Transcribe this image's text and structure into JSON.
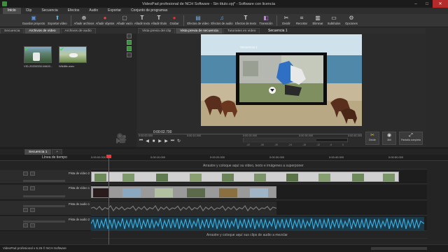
{
  "app": {
    "title": "VideoPad profesional de NCH Software - Sin titulo.vpj* - Software con licencia",
    "window_controls": [
      "minimize-icon",
      "maximize-icon",
      "close-icon"
    ]
  },
  "menu": [
    {
      "label": "Inicio",
      "active": true
    },
    {
      "label": "Clip"
    },
    {
      "label": "Secuencia"
    },
    {
      "label": "Efectos"
    },
    {
      "label": "Audio"
    },
    {
      "label": "Exportar"
    },
    {
      "label": "Conjunto de programas"
    }
  ],
  "toolbar": {
    "items": [
      {
        "label": "Abrir",
        "icon": "folder-icon",
        "color": "#e8b84a"
      },
      {
        "label": "Guardar proyecto",
        "icon": "disk-icon",
        "color": "#5d8fd8"
      },
      {
        "label": "Exportar vídeo",
        "icon": "export-icon",
        "color": "#5fb0e0"
      },
      {
        "label": "Añadir archivos",
        "icon": "add-files-icon",
        "color": "#e0e0e0"
      },
      {
        "label": "Añadir objetos",
        "icon": "add-objects-icon",
        "color": "#d84a4a"
      },
      {
        "label": "Añadir vacío",
        "icon": "add-blank-icon",
        "color": "#aaaaaa"
      },
      {
        "label": "Añadir texto",
        "icon": "text-icon",
        "color": "#e0e0e0"
      },
      {
        "label": "Añadir título",
        "icon": "title-icon",
        "color": "#e0e0e0"
      },
      {
        "label": "Grabar",
        "icon": "record-icon",
        "color": "#e03030"
      },
      {
        "label": "Efectos de vídeo",
        "icon": "video-fx-icon",
        "color": "#7ab0e0"
      },
      {
        "label": "Efectos de audio",
        "icon": "audio-fx-icon",
        "color": "#7ab0e0"
      },
      {
        "label": "Efectos de texto",
        "icon": "text-fx-icon",
        "color": "#e0e0e0"
      },
      {
        "label": "Transición",
        "icon": "transition-icon",
        "color": "#c080e0"
      },
      {
        "label": "Dividir",
        "icon": "split-icon",
        "color": "#e0e0e0"
      },
      {
        "label": "Recortar",
        "icon": "crop-icon",
        "color": "#e0e0e0"
      },
      {
        "label": "Eliminar",
        "icon": "delete-icon",
        "color": "#e0e0e0"
      },
      {
        "label": "Subtítulos",
        "icon": "subtitles-icon",
        "color": "#e0e0e0"
      },
      {
        "label": "Opciones",
        "icon": "gear-icon",
        "color": "#cccccc"
      }
    ]
  },
  "media_panel": {
    "tabs": [
      {
        "label": "Secuencia"
      },
      {
        "label": "Archivos de vídeo",
        "active": true
      },
      {
        "label": "Archivos de audio"
      }
    ],
    "files": [
      {
        "name": "VID-20200330-WA00...",
        "icon": "check-icon"
      },
      {
        "name": "Wildlife.wmv",
        "icon": "check-icon"
      }
    ],
    "side_tools": [
      "add-icon",
      "remove-icon",
      "grid-icon",
      "list-icon"
    ]
  },
  "preview_panel": {
    "tabs": [
      {
        "label": "Vista previa del clip"
      },
      {
        "label": "Vista previa de secuencia",
        "active": true
      },
      {
        "label": "Tutoriales en vídeo"
      }
    ],
    "sequence_label": "Secuencia 1",
    "overlay_text": "Secuencia 1",
    "timecode": "0:00:02.700",
    "seek_ticks": [
      "0:00:00.000",
      "0:00:10.000",
      "0:00:20.000",
      "0:00:30.000",
      "0:00:40.000"
    ],
    "volume_ticks": [
      "-42",
      "-36",
      "-30",
      "-24",
      "-18",
      "-12",
      "-6",
      "0"
    ],
    "buttons": [
      {
        "label": "Dividir",
        "icon": "scissors-icon"
      },
      {
        "label": "360",
        "icon": "vr-icon"
      },
      {
        "label": "Pantalla completa",
        "icon": "fullscreen-icon"
      }
    ]
  },
  "timeline": {
    "tabs": [
      {
        "label": "Secuencia 1",
        "active": true
      },
      {
        "label": "+"
      }
    ],
    "ruler_label": "Línea de tiempo",
    "ruler_ticks": [
      "0:00:00.000",
      "0:00:10.000",
      "0:00:20.000",
      "0:00:30.000",
      "0:00:40.000",
      "0:00:50.000"
    ],
    "tracks": [
      {
        "name": "Pista de vídeo 2",
        "hint": "Arrastre y coloque aquí su vídeo, texto e imágenes a superponer"
      },
      {
        "name": "Pista de vídeo 1"
      },
      {
        "name": "Pista de audio 1"
      },
      {
        "name": "Pista de audio 2",
        "hint": "Arrastre y coloque aquí sus clips de audio a mezclar"
      }
    ]
  },
  "statusbar": {
    "text": "VideoPad profesional v 6.26 © NCH Software"
  }
}
